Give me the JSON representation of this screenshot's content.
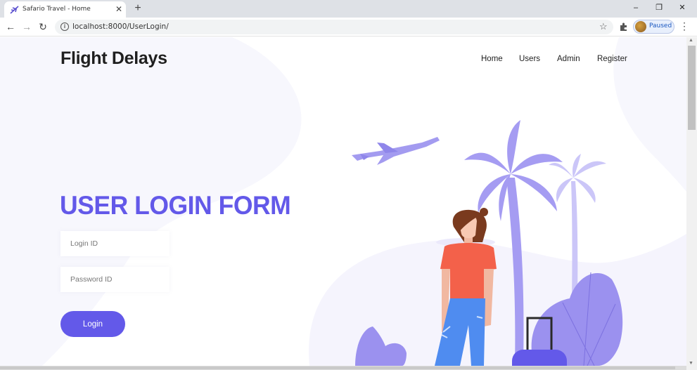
{
  "browser": {
    "tab_title": "Safario Travel - Home",
    "url": "localhost:8000/UserLogin/",
    "profile_status": "Paused",
    "icons": {
      "back": "arrow-left-icon",
      "forward": "arrow-right-icon",
      "reload": "reload-icon",
      "info": "info-icon",
      "bookmark": "star-icon",
      "extensions": "puzzle-icon",
      "menu": "kebab-menu-icon"
    }
  },
  "site": {
    "brand": "Flight Delays",
    "nav": [
      {
        "label": "Home"
      },
      {
        "label": "Users"
      },
      {
        "label": "Admin"
      },
      {
        "label": "Register"
      }
    ]
  },
  "form": {
    "title": "USER LOGIN FORM",
    "login_placeholder": "Login ID",
    "password_placeholder": "Password ID",
    "login_value": "",
    "password_value": "",
    "submit_label": "Login"
  },
  "colors": {
    "accent": "#6359e9",
    "palm": "#a59cf2",
    "palm_light": "#cbc6f8",
    "shirt": "#f3614a",
    "jeans": "#4f8cf0",
    "hair": "#7a3a1e"
  }
}
